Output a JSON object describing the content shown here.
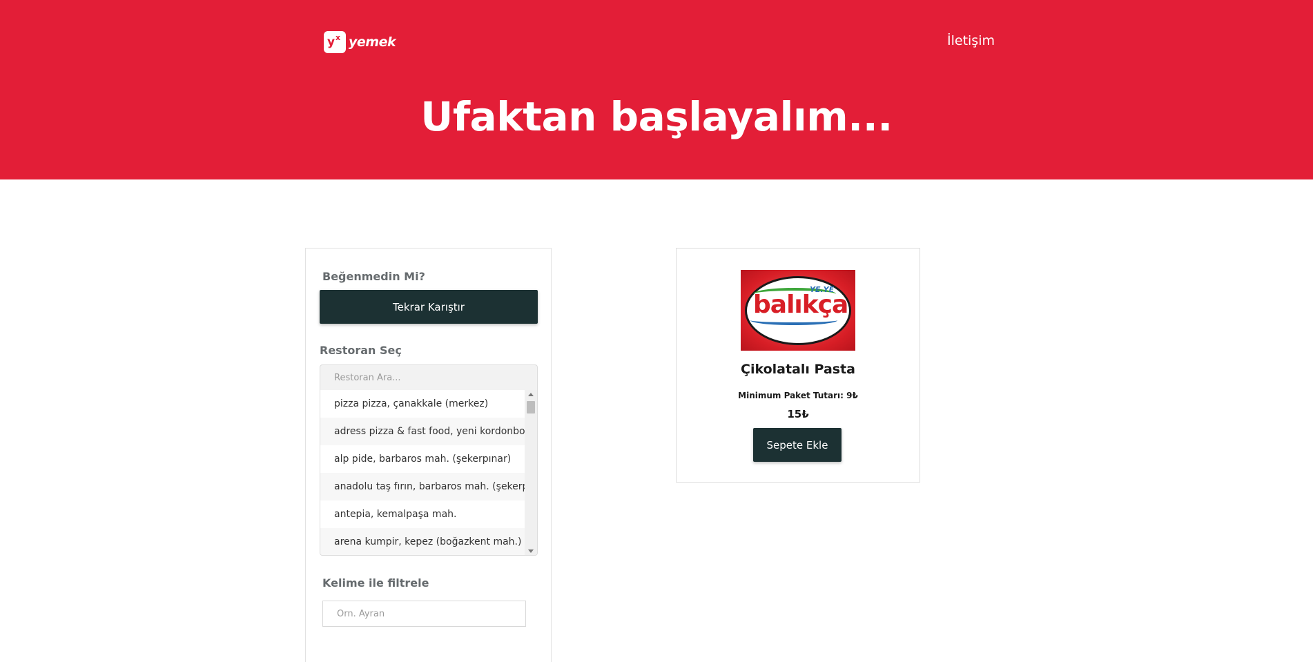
{
  "header": {
    "logo_text": "yemek",
    "logo_mark": "yx",
    "contact_link": "İletişim"
  },
  "hero": {
    "title": "Ufaktan başlayalım..."
  },
  "sidebar": {
    "dislike_label": "Beğenmedin Mi?",
    "shuffle_button": "Tekrar Karıştır",
    "restaurant_label": "Restoran Seç",
    "restaurant_search_placeholder": "Restoran Ara...",
    "restaurants": [
      "pizza pizza, çanakkale (merkez)",
      "adress pizza & fast food, yeni kordonboyu",
      "alp pide, barbaros mah. (şekerpınar)",
      "anadolu taş fırın, barbaros mah. (şekerpınar)",
      "antepia, kemalpaşa mah.",
      "arena kumpir, kepez (boğazkent mah.)"
    ],
    "filter_label": "Kelime ile filtrele",
    "filter_placeholder": "Örn. Ayran"
  },
  "product": {
    "restaurant_logo_text": "balıkça",
    "restaurant_logo_tag": "YE.YE",
    "name": "Çikolatalı Pasta",
    "min_order": "Minimum Paket Tutarı: 9₺",
    "price": "15₺",
    "add_to_cart": "Sepete Ekle"
  },
  "colors": {
    "brand_red": "#e31e37",
    "button_dark": "#1c3133"
  }
}
